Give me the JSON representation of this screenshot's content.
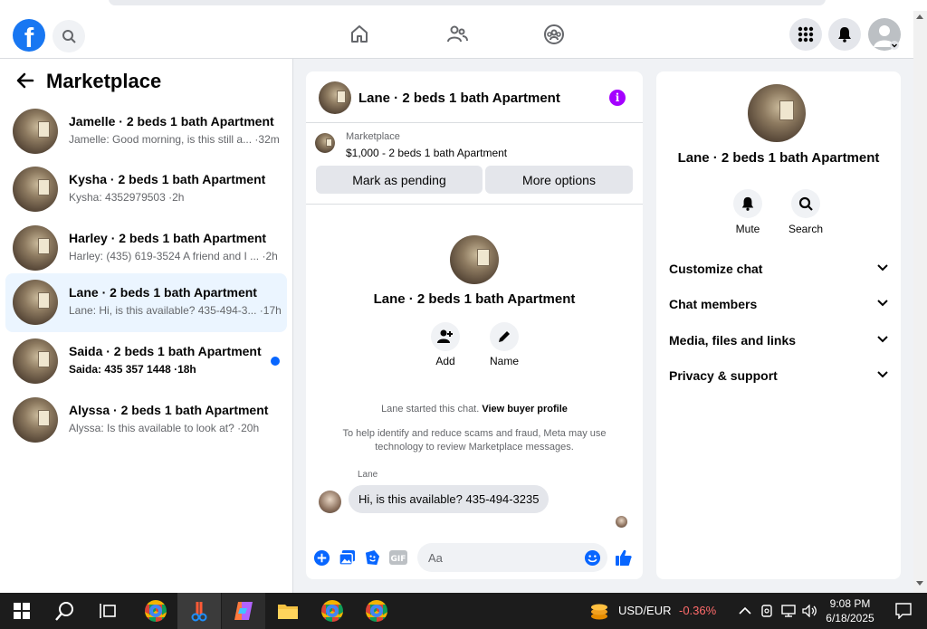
{
  "nav": {
    "logo": "f"
  },
  "sidebar": {
    "title": "Marketplace",
    "conversations": [
      {
        "name": "Jamelle · 2 beds 1 bath Apartment",
        "preview": "Jamelle: Good morning, is this still a... ·32m",
        "active": false,
        "unread": false
      },
      {
        "name": "Kysha · 2 beds 1 bath Apartment",
        "preview": "Kysha: 4352979503 ·2h",
        "active": false,
        "unread": false
      },
      {
        "name": "Harley · 2 beds 1 bath Apartment",
        "preview": "Harley: (435) 619-3524 A friend and I ... ·2h",
        "active": false,
        "unread": false
      },
      {
        "name": "Lane · 2 beds 1 bath Apartment",
        "preview": "Lane: Hi, is this available? 435-494-3... ·17h",
        "active": true,
        "unread": false
      },
      {
        "name": "Saida · 2 beds 1 bath Apartment",
        "preview": "Saida: 435 357 1448 ·18h",
        "active": false,
        "unread": true
      },
      {
        "name": "Alyssa · 2 beds 1 bath Apartment",
        "preview": "Alyssa: Is this available to look at? ·20h",
        "active": false,
        "unread": false
      }
    ]
  },
  "chat": {
    "title": "Lane · 2 beds 1 bath Apartment",
    "info_icon": "i",
    "listing": {
      "source": "Marketplace",
      "price_title": "$1,000 - 2 beds 1 bath Apartment",
      "mark_pending": "Mark as pending",
      "more_options": "More options"
    },
    "profile_name": "Lane · 2 beds 1 bath Apartment",
    "actions": {
      "add": "Add",
      "name": "Name"
    },
    "system_started": "Lane started this chat. ",
    "system_link": "View buyer profile",
    "system_notice": "To help identify and reduce scams and fraud, Meta may use technology to review Marketplace messages.",
    "sender": "Lane",
    "message": "Hi, is this available? 435-494-3235",
    "composer_placeholder": "Aa"
  },
  "details": {
    "name": "Lane · 2 beds 1 bath Apartment",
    "mute": "Mute",
    "search": "Search",
    "rows": [
      "Customize chat",
      "Chat members",
      "Media, files and links",
      "Privacy & support"
    ]
  },
  "taskbar": {
    "currency": "USD/EUR",
    "change": "-0.36%",
    "time": "9:08 PM",
    "date": "6/18/2025"
  },
  "colors": {
    "brand": "#1877f2",
    "unread_dot": "#0866ff",
    "info": "#a400ff",
    "negative": "#ff6b6b"
  }
}
